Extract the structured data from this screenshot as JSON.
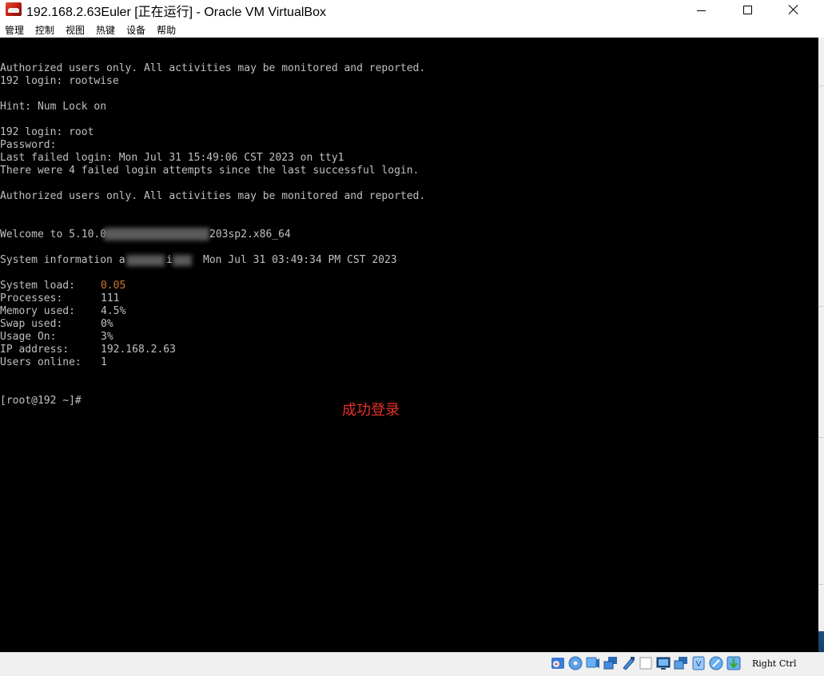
{
  "window": {
    "title": "192.168.2.63Euler [正在运行] - Oracle VM VirtualBox",
    "controls": [
      "minimize",
      "maximize",
      "close"
    ]
  },
  "menu": {
    "items": [
      "管理",
      "控制",
      "视图",
      "热键",
      "设备",
      "帮助"
    ]
  },
  "console": {
    "lines": {
      "banner1": "Authorized users only. All activities may be monitored and reported.",
      "login1": "192 login: rootwise",
      "hint": "Hint: Num Lock on",
      "login2": "192 login: root",
      "password": "Password:",
      "last_failed": "Last failed login: Mon Jul 31 15:49:06 CST 2023 on tty1",
      "failed_attempts": "There were 4 failed login attempts since the last successful login.",
      "banner2": "Authorized users only. All activities may be monitored and reported.",
      "welcome_prefix": "Welcome to 5.10.0",
      "welcome_suffix": "203sp2.x86_64",
      "sysinfo_prefix": "System information a",
      "sysinfo_mid": "i",
      "sysinfo_date": "Mon Jul 31 03:49:34 PM CST 2023",
      "prompt": "[root@192 ~]#"
    },
    "stats": [
      {
        "label": "System load:",
        "value": "0.05",
        "highlight": true
      },
      {
        "label": "Processes:",
        "value": "111",
        "highlight": false
      },
      {
        "label": "Memory used:",
        "value": "4.5%",
        "highlight": false
      },
      {
        "label": "Swap used:",
        "value": "0%",
        "highlight": false
      },
      {
        "label": "Usage On:",
        "value": "3%",
        "highlight": false
      },
      {
        "label": "IP address:",
        "value": "192.168.2.63",
        "highlight": false
      },
      {
        "label": "Users online:",
        "value": "1",
        "highlight": false
      }
    ],
    "annotation": "成功登录"
  },
  "statusbar": {
    "host_key": "Right Ctrl",
    "icons": [
      "hard-disk-icon",
      "optical-drive-icon",
      "audio-icon",
      "network-icon",
      "usb-icon",
      "shared-folders-icon",
      "display-icon",
      "video-capture-icon",
      "mouse-integration-icon",
      "virtualization-icon",
      "recording-icon",
      "keyboard-icon"
    ]
  },
  "colors": {
    "console_bg": "#000000",
    "console_text": "#c0c0c0",
    "load_value": "#d0782c",
    "annotation": "#e8302a"
  }
}
